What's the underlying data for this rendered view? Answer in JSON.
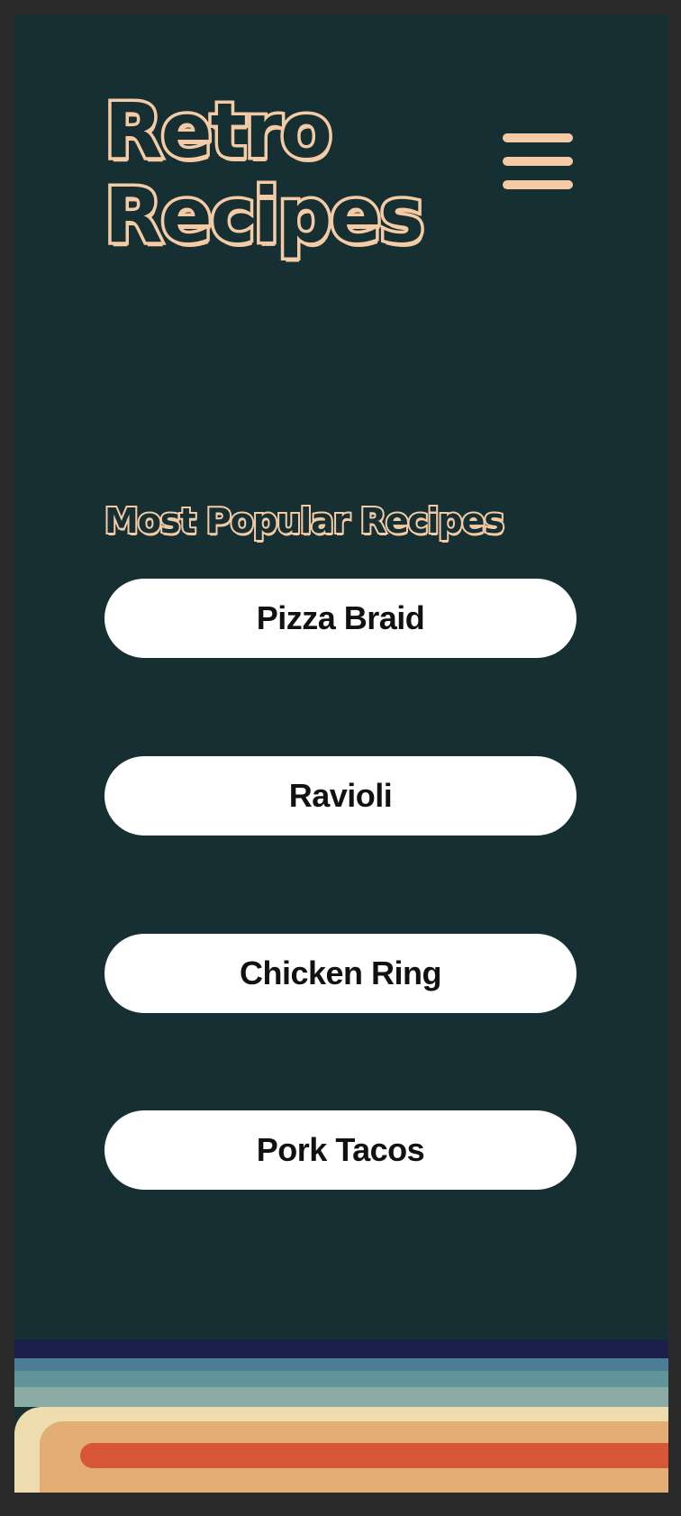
{
  "header": {
    "title_line1": "Retro",
    "title_line2": "Recipes",
    "menu_icon": "hamburger-menu-icon"
  },
  "popular": {
    "heading": "Most Popular Recipes",
    "recipes": [
      "Pizza Braid",
      "Ravioli",
      "Chicken Ring",
      "Pork Tacos"
    ]
  },
  "colors": {
    "background": "#152f33",
    "outer_background": "#2a2a2a",
    "accent_peach": "#f5cba6",
    "button_fill": "#ffffff",
    "button_text": "#111111",
    "stripes": [
      "#1c1f4a",
      "#4d7d96",
      "#5f9499",
      "#8aaca5",
      "#eedcae",
      "#e2ae76",
      "#d7563a"
    ]
  }
}
